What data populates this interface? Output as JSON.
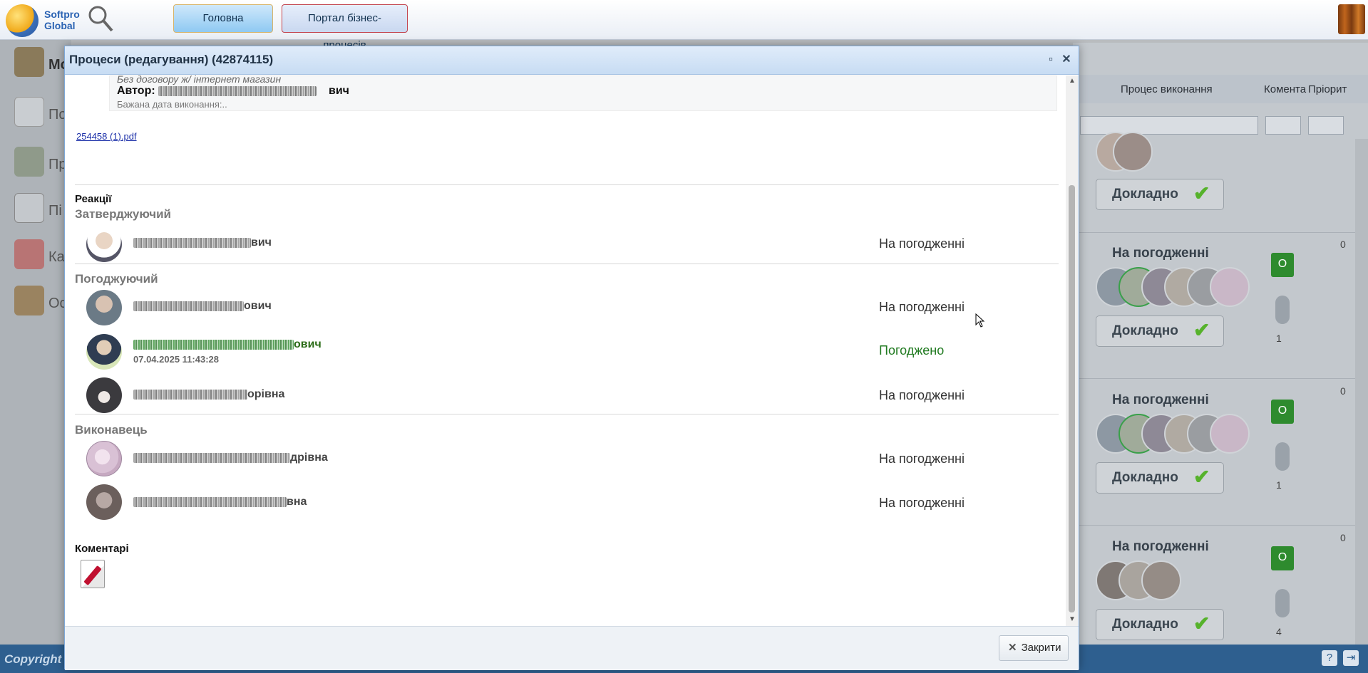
{
  "app": {
    "logo_text_1": "Softpro",
    "logo_text_2": "Global",
    "nav": {
      "home": "Головна",
      "portal": "Портал бізнес-процесів"
    }
  },
  "sidebar": {
    "items": [
      {
        "label": "Мо",
        "icon": "user-briefcase-icon"
      },
      {
        "label": "По",
        "icon": "mail-icon"
      },
      {
        "label": "Пр",
        "icon": "users-icon"
      },
      {
        "label": "Пі",
        "icon": "org-chart-icon"
      },
      {
        "label": "Ка",
        "icon": "calendar-icon"
      },
      {
        "label": "Ос",
        "icon": "briefcase-icon"
      }
    ]
  },
  "grid": {
    "headers": {
      "process": "Процес виконання",
      "comments": "Комента",
      "priority": "Пріорит"
    },
    "rows": [
      {
        "status": "",
        "details": "Докладно",
        "comment_badge": "",
        "comment_count": "",
        "priority": ""
      },
      {
        "status": "На погодженні",
        "details": "Докладно",
        "comment_badge": "О",
        "comment_count": "1",
        "priority": "0"
      },
      {
        "status": "На погодженні",
        "details": "Докладно",
        "comment_badge": "О",
        "comment_count": "1",
        "priority": "0"
      },
      {
        "status": "На погодженні",
        "details": "Докладно",
        "comment_badge": "О",
        "comment_count": "4",
        "priority": "0"
      }
    ]
  },
  "footer": {
    "copyright": "Copyright"
  },
  "dialog": {
    "title": "Процеси (редагування) (42874115)",
    "card": {
      "italic_line": "Без договору ж/ інтернет магазин",
      "author_label": "Автор:",
      "author_suffix": "вич",
      "desired_date": "Бажана дата виконання:.."
    },
    "attachment": "254458 (1).pdf",
    "reactions_title": "Реакції",
    "groups": {
      "approver": "Затверджуючий",
      "agreeing": "Погоджуючий",
      "executor": "Виконавець"
    },
    "people": [
      {
        "name_suffix": "вич",
        "status": "На погодженні",
        "date": ""
      },
      {
        "name_suffix": "ович",
        "status": "На погодженні",
        "date": ""
      },
      {
        "name_suffix": "ович",
        "status": "Погоджено",
        "date": "07.04.2025 11:43:28"
      },
      {
        "name_suffix": "орівна",
        "status": "На погодженні",
        "date": ""
      },
      {
        "name_suffix": "дрівна",
        "status": "На погодженні",
        "date": ""
      },
      {
        "name_suffix": "вна",
        "status": "На погодженні",
        "date": ""
      }
    ],
    "comments_title": "Коментарі",
    "close_label": "Закрити"
  },
  "colors": {
    "accent": "#2e5f8f",
    "approved": "#207a20",
    "badge": "#2e8b2e"
  }
}
